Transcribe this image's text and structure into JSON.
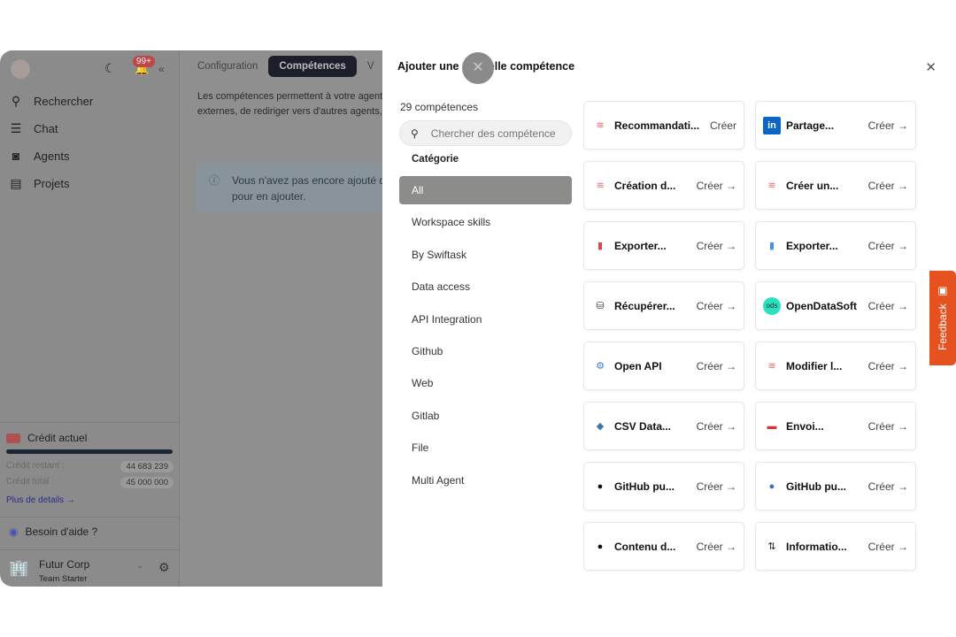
{
  "sidebar": {
    "badge": "99+",
    "items": [
      {
        "label": "Rechercher",
        "icon": "search-icon"
      },
      {
        "label": "Chat",
        "icon": "chat-icon"
      },
      {
        "label": "Agents",
        "icon": "robot-icon"
      },
      {
        "label": "Projets",
        "icon": "clipboard-icon"
      }
    ],
    "credit": {
      "title": "Crédit actuel",
      "remaining_label": "Crédit restant :",
      "remaining": "44 683 239",
      "total_label": "Crédit total :",
      "total": "45 000 000",
      "details": "Plus de details",
      "progress": 0.993
    },
    "help": "Besoin d'aide ?",
    "org": {
      "name": "Futur Corp",
      "plan": "Team Starter"
    }
  },
  "main": {
    "tabs": [
      "Configuration",
      "Compétences",
      "V"
    ],
    "desc1": "Les compétences permettent à votre agent",
    "desc2": "externes, de rediriger vers d'autres agents,",
    "info1": "Vous n'avez pas encore ajouté de",
    "info2": "pour en ajouter."
  },
  "modal": {
    "title": "Ajouter une nouvelle compétence",
    "count": "29 compétences",
    "search_placeholder": "Chercher des compétence",
    "category_title": "Catégorie",
    "categories": [
      "All",
      "Workspace skills",
      "By Swiftask",
      "Data access",
      "API Integration",
      "Github",
      "Web",
      "Gitlab",
      "File",
      "Multi Agent"
    ],
    "create_label": "Créer",
    "skills": [
      {
        "name": "Recommandati...",
        "icon": "swiftask-icon",
        "color": "#e8676b"
      },
      {
        "name": "Partage...",
        "icon": "linkedin-icon",
        "color": "#0a66c2"
      },
      {
        "name": "Création d...",
        "icon": "swiftask-icon",
        "color": "#e8676b"
      },
      {
        "name": "Créer un...",
        "icon": "swiftask-icon",
        "color": "#e8676b"
      },
      {
        "name": "Exporter...",
        "icon": "xlsx-file-icon",
        "color": "#d9474a"
      },
      {
        "name": "Exporter...",
        "icon": "doc-file-icon",
        "color": "#4a8fe0"
      },
      {
        "name": "Récupérer...",
        "icon": "database-icon",
        "color": "#333333"
      },
      {
        "name": "OpenDataSoft",
        "icon": "ods-icon",
        "color": "#2de0c0"
      },
      {
        "name": "Open API",
        "icon": "openapi-icon",
        "color": "#3b7bd6"
      },
      {
        "name": "Modifier l...",
        "icon": "swiftask-icon",
        "color": "#e8676b"
      },
      {
        "name": "CSV Data...",
        "icon": "python-icon",
        "color": "#3b77a8"
      },
      {
        "name": "Envoi...",
        "icon": "mail-icon",
        "color": "#d33"
      },
      {
        "name": "GitHub pu...",
        "icon": "github-icon",
        "color": "#111111"
      },
      {
        "name": "GitHub pu...",
        "icon": "github-icon",
        "color": "#3b6fb0"
      },
      {
        "name": "Contenu d...",
        "icon": "github-icon",
        "color": "#111111"
      },
      {
        "name": "Informatio...",
        "icon": "pull-request-icon",
        "color": "#222222"
      }
    ]
  },
  "feedback": "Feedback"
}
